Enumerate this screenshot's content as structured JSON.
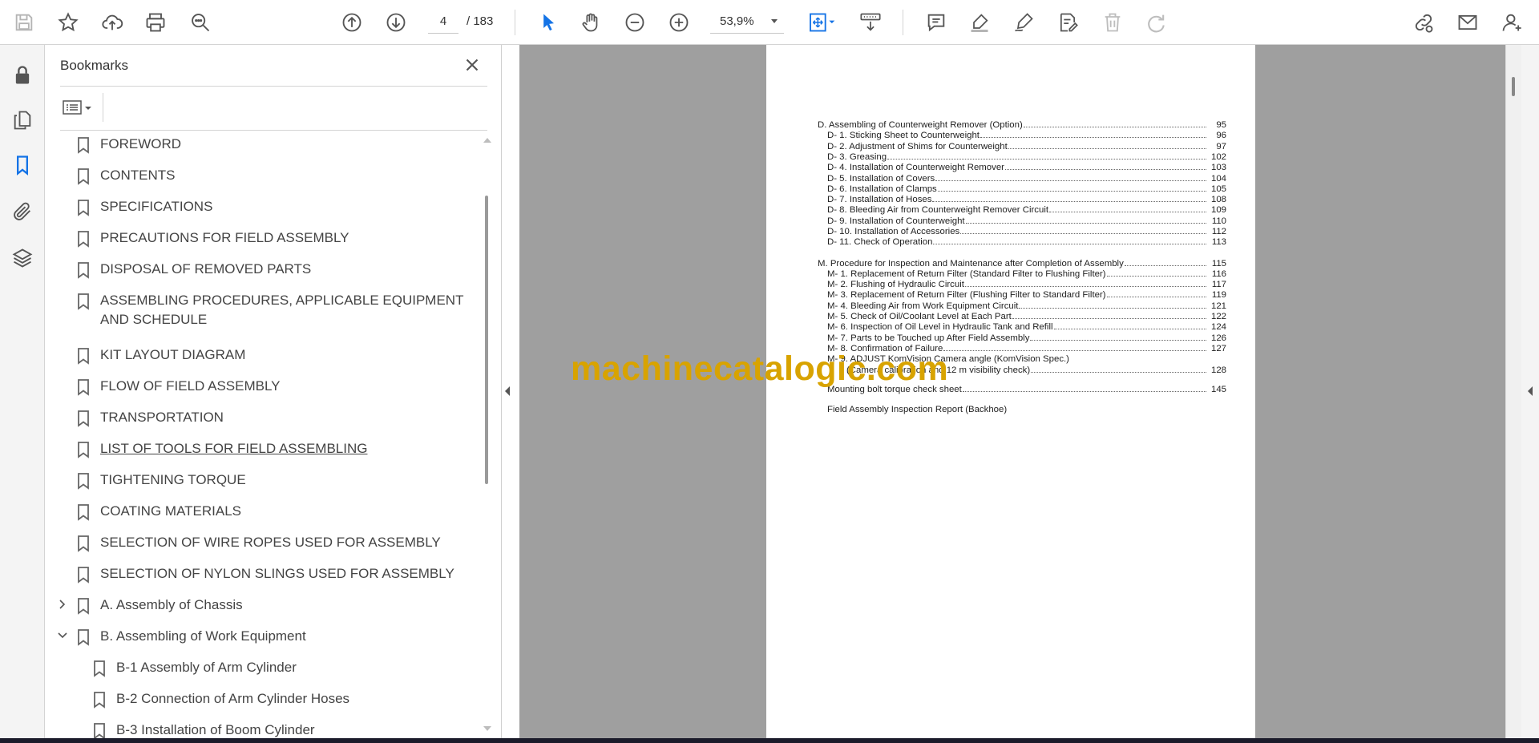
{
  "toolbar": {
    "icons": [
      "save-icon",
      "star-icon",
      "upload-icon",
      "print-icon",
      "find-icon",
      "page-up-icon",
      "page-down-icon",
      "select-cursor-icon",
      "hand-icon",
      "zoom-out-icon",
      "zoom-in-icon",
      "fit-page-icon",
      "scroll-mode-icon",
      "comment-icon",
      "highlight-icon",
      "draw-icon",
      "fill-sign-icon",
      "delete-icon",
      "redo-icon",
      "share-link-icon",
      "email-icon",
      "account-icon"
    ],
    "current_page": "4",
    "page_total": "/  183",
    "zoom": "53,9%",
    "accent": "#1473e6"
  },
  "left_rail": {
    "icons": [
      "lock-icon",
      "pages-icon",
      "bookmark-icon",
      "attachment-icon",
      "layers-icon"
    ]
  },
  "bookmarks": {
    "title": "Bookmarks",
    "items": [
      {
        "label": "FOREWORD"
      },
      {
        "label": "CONTENTS"
      },
      {
        "label": "SPECIFICATIONS"
      },
      {
        "label": "PRECAUTIONS FOR FIELD ASSEMBLY"
      },
      {
        "label": "DISPOSAL OF REMOVED PARTS"
      },
      {
        "label": "ASSEMBLING PROCEDURES, APPLICABLE EQUIPMENT AND SCHEDULE"
      },
      {
        "label": "KIT LAYOUT DIAGRAM"
      },
      {
        "label": "FLOW OF FIELD ASSEMBLY"
      },
      {
        "label": "TRANSPORTATION"
      },
      {
        "label": "LIST OF TOOLS FOR FIELD ASSEMBLING"
      },
      {
        "label": "TIGHTENING TORQUE"
      },
      {
        "label": "COATING MATERIALS"
      },
      {
        "label": "SELECTION OF WIRE ROPES USED FOR ASSEMBLY"
      },
      {
        "label": "SELECTION OF NYLON SLINGS USED FOR ASSEMBLY"
      },
      {
        "label": "A. Assembly of Chassis",
        "expander": "collapsed"
      },
      {
        "label": "B. Assembling of Work Equipment",
        "expander": "expanded"
      },
      {
        "label": "B-1 Assembly of Arm Cylinder",
        "child": true
      },
      {
        "label": "B-2 Connection of Arm Cylinder Hoses",
        "child": true
      },
      {
        "label": "B-3 Installation of Boom Cylinder",
        "child": true
      }
    ]
  },
  "document": {
    "toc": [
      {
        "text": "D. Assembling of Counterweight Remover  (Option)",
        "page": "95",
        "level": 0
      },
      {
        "text": "D-  1. Sticking Sheet to Counterweight",
        "page": "96",
        "level": 1
      },
      {
        "text": "D-  2. Adjustment of Shims for Counterweight",
        "page": "97",
        "level": 1
      },
      {
        "text": "D-  3. Greasing",
        "page": "102",
        "level": 1
      },
      {
        "text": "D-  4. Installation of Counterweight Remover",
        "page": "103",
        "level": 1
      },
      {
        "text": "D-  5. Installation of Covers",
        "page": "104",
        "level": 1
      },
      {
        "text": "D-  6. Installation of Clamps",
        "page": "105",
        "level": 1
      },
      {
        "text": "D-  7. Installation of Hoses",
        "page": "108",
        "level": 1
      },
      {
        "text": "D-  8. Bleeding Air from Counterweight Remover Circuit",
        "page": "109",
        "level": 1
      },
      {
        "text": "D-  9. Installation of Counterweight",
        "page": "110",
        "level": 1
      },
      {
        "text": "D-  10. Installation of Accessories",
        "page": "112",
        "level": 1
      },
      {
        "text": "D-  11. Check of Operation",
        "page": "113",
        "level": 1
      },
      {
        "text": "M. Procedure for Inspection and Maintenance after Completion of Assembly",
        "page": "115",
        "level": 0
      },
      {
        "text": "M-  1. Replacement of Return Filter (Standard Filter to Flushing Filter)",
        "page": "116",
        "level": 1
      },
      {
        "text": "M-  2. Flushing of Hydraulic Circuit",
        "page": "117",
        "level": 1
      },
      {
        "text": "M-  3. Replacement of Return Filter (Flushing Filter to Standard Filter)",
        "page": "119",
        "level": 1
      },
      {
        "text": "M-  4. Bleeding Air from Work Equipment Circuit",
        "page": "121",
        "level": 1
      },
      {
        "text": "M-  5. Check of Oil/Coolant Level at Each Part",
        "page": "122",
        "level": 1
      },
      {
        "text": "M-  6. Inspection of Oil Level in Hydraulic Tank and Refill",
        "page": "124",
        "level": 1
      },
      {
        "text": "M-  7. Parts to be Touched up After Field Assembly",
        "page": "126",
        "level": 1
      },
      {
        "text": "M-  8. Confirmation of Failure",
        "page": "127",
        "level": 1
      },
      {
        "text": "M-  9. ADJUST  KomVision  Camera  angle  (KomVision  Spec.)",
        "page": "",
        "level": 1,
        "nodots": true
      },
      {
        "text": "(Camera calibration and 12 m visibility check)",
        "page": "128",
        "level": 2
      },
      {
        "text": "Mounting bolt torque check sheet",
        "page": "145",
        "level": 1
      },
      {
        "text": "Field Assembly Inspection Report (Backhoe)",
        "page": "",
        "level": 1,
        "nodots": true
      }
    ],
    "watermark": "machinecatalogic.com",
    "watermark_color": "#d8a300"
  }
}
